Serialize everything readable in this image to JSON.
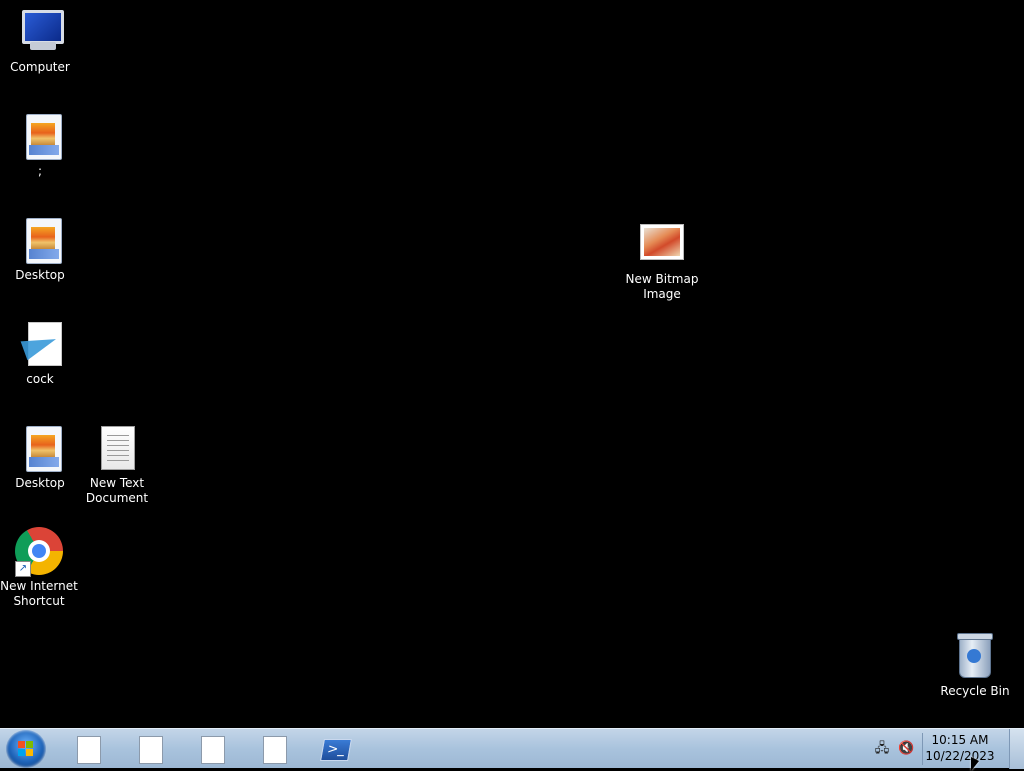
{
  "desktop": {
    "icons": [
      {
        "label": "Computer",
        "icon": "computer-icon"
      },
      {
        "label": ";",
        "icon": "image-file-icon"
      },
      {
        "label": "Desktop",
        "icon": "image-file-icon"
      },
      {
        "label": "cock",
        "icon": "paper-plane-document-icon"
      },
      {
        "label": "Desktop",
        "icon": "image-file-icon"
      },
      {
        "label": "New Text Document",
        "icon": "text-document-icon"
      },
      {
        "label": "New Internet Shortcut",
        "icon": "chrome-icon"
      },
      {
        "label": "New Bitmap Image",
        "icon": "bitmap-image-icon"
      },
      {
        "label": "Recycle Bin",
        "icon": "recycle-bin-icon"
      }
    ]
  },
  "taskbar": {
    "start_icon": "windows-logo-icon",
    "pinned": [
      {
        "icon": "document-icon"
      },
      {
        "icon": "document-icon"
      },
      {
        "icon": "document-icon"
      },
      {
        "icon": "document-icon"
      },
      {
        "icon": "powershell-icon"
      }
    ],
    "tray": {
      "network_icon": "network-icon",
      "volume_icon": "volume-muted-icon",
      "time": "10:15 AM",
      "date": "10/22/2023"
    }
  },
  "colors": {
    "desktop_background": "#000000",
    "taskbar": "#a9c3dd",
    "label_text": "#ffffff"
  }
}
